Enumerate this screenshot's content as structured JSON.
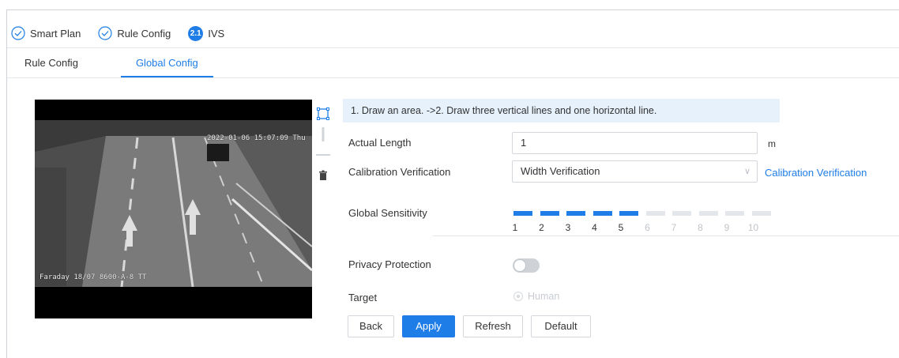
{
  "breadcrumb": {
    "items": [
      {
        "label": "Smart Plan",
        "state": "done"
      },
      {
        "label": "Rule Config",
        "state": "done"
      },
      {
        "label": "IVS",
        "step": "2.1",
        "state": "current"
      }
    ]
  },
  "tabs": [
    {
      "label": "Rule Config",
      "active": false
    },
    {
      "label": "Global Config",
      "active": true
    }
  ],
  "video": {
    "osd_time": "2022-01-06 15:07:09 Thu",
    "osd_name": "Faraday 18/07 8600-A-8 TT"
  },
  "tools": [
    "draw-area-icon",
    "vertical-line-icon",
    "horizontal-line-icon",
    "delete-icon"
  ],
  "form": {
    "hint": "1. Draw an area. ->2. Draw three vertical lines and one horizontal line.",
    "actual_length": {
      "label": "Actual Length",
      "value": "1",
      "unit": "m"
    },
    "calibration": {
      "label": "Calibration Verification",
      "value": "Width Verification",
      "link": "Calibration Verification"
    },
    "sensitivity": {
      "label": "Global Sensitivity",
      "value": 5,
      "ticks": [
        "1",
        "2",
        "3",
        "4",
        "5",
        "6",
        "7",
        "8",
        "9",
        "10"
      ]
    },
    "privacy": {
      "label": "Privacy Protection",
      "enabled": false
    },
    "target": {
      "label": "Target",
      "option": "Human",
      "disabled": true
    }
  },
  "buttons": {
    "back": "Back",
    "apply": "Apply",
    "refresh": "Refresh",
    "default": "Default"
  },
  "colors": {
    "accent": "#1e7de6",
    "hint_bg": "#e6f1fc",
    "border": "#d3d7dc"
  }
}
